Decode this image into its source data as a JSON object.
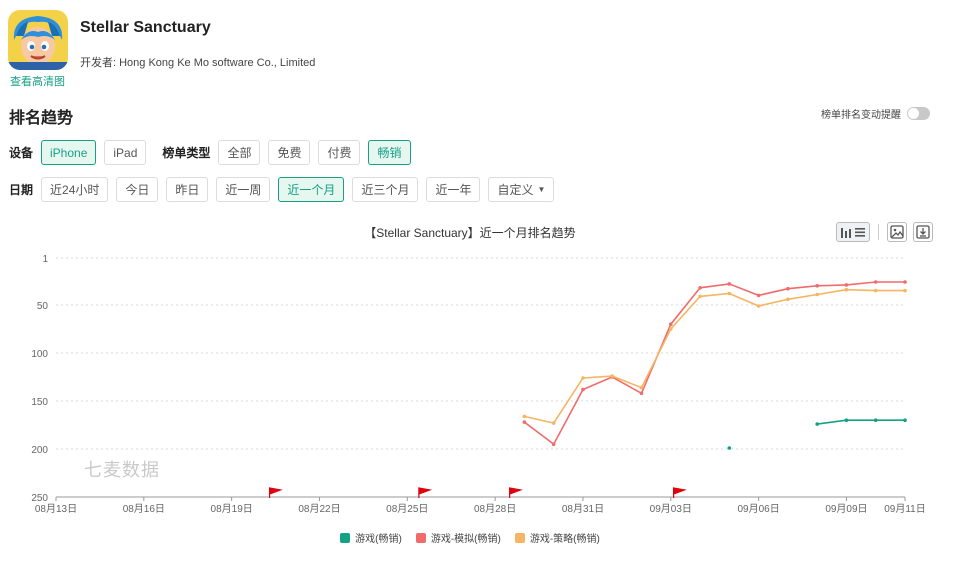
{
  "app": {
    "name": "Stellar Sanctuary",
    "developer": "开发者: Hong Kong Ke Mo software Co., Limited",
    "hd_link": "查看高清图"
  },
  "section": {
    "title": "排名趋势",
    "alert_label": "榜单排名变动提醒",
    "alert_enabled": false
  },
  "filters": {
    "device_label": "设备",
    "devices": [
      {
        "label": "iPhone",
        "active": true
      },
      {
        "label": "iPad",
        "active": false
      }
    ],
    "list_type_label": "榜单类型",
    "list_types": [
      {
        "label": "全部",
        "active": false
      },
      {
        "label": "免费",
        "active": false
      },
      {
        "label": "付费",
        "active": false
      },
      {
        "label": "畅销",
        "active": true
      }
    ],
    "date_label": "日期",
    "dates": [
      {
        "label": "近24小时",
        "active": false
      },
      {
        "label": "今日",
        "active": false
      },
      {
        "label": "昨日",
        "active": false
      },
      {
        "label": "近一周",
        "active": false
      },
      {
        "label": "近一个月",
        "active": true
      },
      {
        "label": "近三个月",
        "active": false
      },
      {
        "label": "近一年",
        "active": false
      }
    ],
    "custom_label": "自定义"
  },
  "toolbar": {
    "view_icon": "chart-list-toggle-icon",
    "image_icon": "image-icon",
    "download_icon": "download-icon"
  },
  "watermark": "七麦数据",
  "colors": {
    "accent": "#16a085",
    "series_total": "#16a085",
    "series_sim": "#f06b6b",
    "series_strategy": "#f5b563",
    "event_flag": "#e0000f"
  },
  "chart_data": {
    "type": "line",
    "title": "【Stellar Sanctuary】近一个月排名趋势",
    "x_tick_labels": [
      "08月13日",
      "08月16日",
      "08月19日",
      "08月22日",
      "08月25日",
      "08月28日",
      "08月31日",
      "09月03日",
      "09月06日",
      "09月09日",
      "09月11日"
    ],
    "x_tick_days": [
      0,
      3,
      6,
      9,
      12,
      15,
      18,
      21,
      24,
      27,
      29
    ],
    "y_tick_labels": [
      "1",
      "50",
      "100",
      "150",
      "200",
      "250"
    ],
    "y_tick_values": [
      1,
      50,
      100,
      150,
      200,
      250
    ],
    "ylim": [
      1,
      250
    ],
    "y_inverted": true,
    "grid": true,
    "legend_position": "bottom-center",
    "series": [
      {
        "name": "游戏(畅销)",
        "color": "#16a085",
        "points": [
          [
            23,
            199
          ],
          [
            26,
            174
          ],
          [
            27,
            170
          ],
          [
            28,
            170
          ],
          [
            29,
            170
          ]
        ]
      },
      {
        "name": "游戏-模拟(畅销)",
        "color": "#f06b6b",
        "points": [
          [
            16,
            172
          ],
          [
            17,
            195
          ],
          [
            18,
            138
          ],
          [
            19,
            125
          ],
          [
            20,
            142
          ],
          [
            21,
            70
          ],
          [
            22,
            32
          ],
          [
            23,
            28
          ],
          [
            24,
            40
          ],
          [
            25,
            33
          ],
          [
            26,
            30
          ],
          [
            27,
            29
          ],
          [
            28,
            26
          ],
          [
            29,
            26
          ]
        ]
      },
      {
        "name": "游戏-策略(畅销)",
        "color": "#f5b563",
        "points": [
          [
            16,
            166
          ],
          [
            17,
            173
          ],
          [
            18,
            126
          ],
          [
            19,
            124
          ],
          [
            20,
            136
          ],
          [
            21,
            75
          ],
          [
            22,
            41
          ],
          [
            23,
            38
          ],
          [
            24,
            51
          ],
          [
            25,
            44
          ],
          [
            26,
            39
          ],
          [
            27,
            34
          ],
          [
            28,
            35
          ],
          [
            29,
            35
          ]
        ]
      }
    ],
    "event_flag_days": [
      7.5,
      12.6,
      15.7,
      21.3
    ]
  }
}
